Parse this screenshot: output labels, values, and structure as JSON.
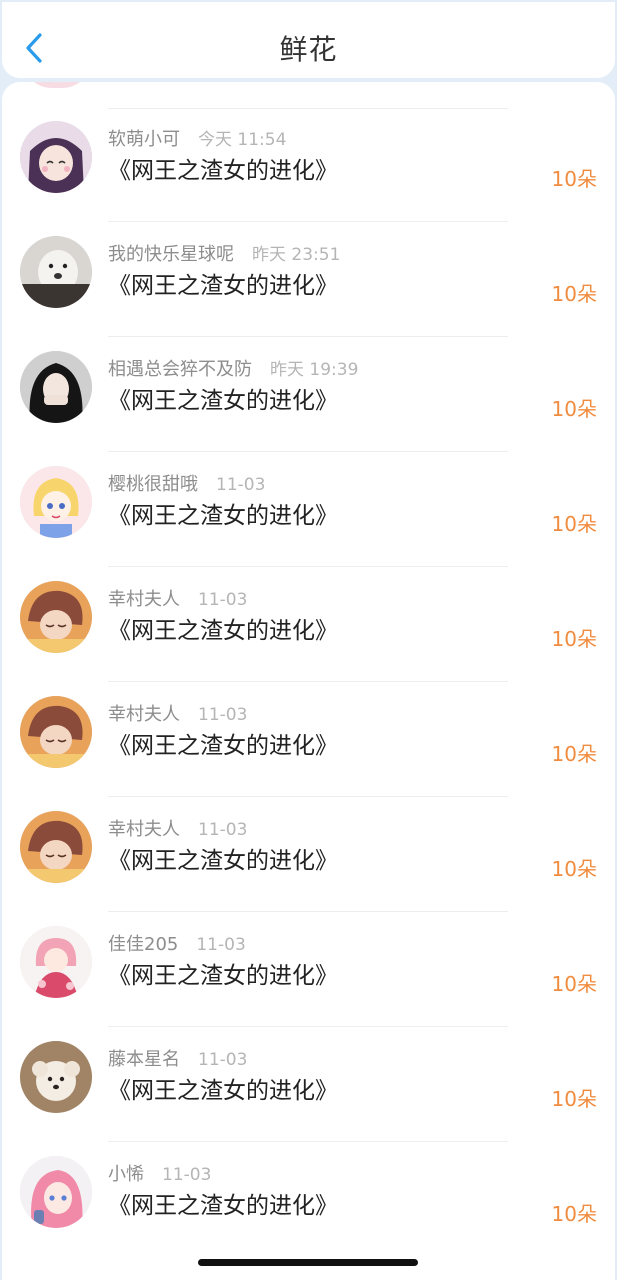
{
  "header": {
    "title": "鲜花",
    "back_icon": "chevron-left-icon"
  },
  "colors": {
    "accent": "#f08c3f",
    "back": "#2a9bea",
    "background": "#e3edf7"
  },
  "items": [
    {
      "name": "软萌小可",
      "time": "今天 11:54",
      "book": "《网王之渣女的进化》",
      "count": "10朵",
      "avatar": "anime-girl-purple"
    },
    {
      "name": "我的快乐星球呢",
      "time": "昨天 23:51",
      "book": "《网王之渣女的进化》",
      "count": "10朵",
      "avatar": "dog-meme"
    },
    {
      "name": "相遇总会猝不及防",
      "time": "昨天 19:39",
      "book": "《网王之渣女的进化》",
      "count": "10朵",
      "avatar": "girl-black-hair"
    },
    {
      "name": "樱桃很甜哦",
      "time": "11-03",
      "book": "《网王之渣女的进化》",
      "count": "10朵",
      "avatar": "sailor-moon"
    },
    {
      "name": "幸村夫人",
      "time": "11-03",
      "book": "《网王之渣女的进化》",
      "count": "10朵",
      "avatar": "anime-boy-sleeping"
    },
    {
      "name": "幸村夫人",
      "time": "11-03",
      "book": "《网王之渣女的进化》",
      "count": "10朵",
      "avatar": "anime-boy-sleeping"
    },
    {
      "name": "幸村夫人",
      "time": "11-03",
      "book": "《网王之渣女的进化》",
      "count": "10朵",
      "avatar": "anime-boy-sleeping"
    },
    {
      "name": "佳佳205",
      "time": "11-03",
      "book": "《网王之渣女的进化》",
      "count": "10朵",
      "avatar": "anime-girl-floral"
    },
    {
      "name": "藤本星名",
      "time": "11-03",
      "book": "《网王之渣女的进化》",
      "count": "10朵",
      "avatar": "white-puppy"
    },
    {
      "name": "小悕",
      "time": "11-03",
      "book": "《网王之渣女的进化》",
      "count": "10朵",
      "avatar": "anime-girl-pink-hair"
    }
  ]
}
